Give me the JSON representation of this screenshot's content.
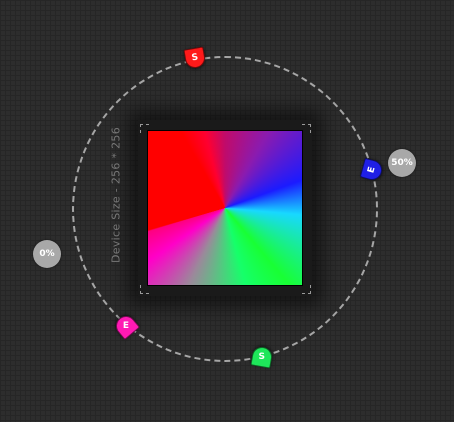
{
  "canvas": {
    "device_size_label": "Device Size - 256 * 256"
  },
  "percent_badges": {
    "left": "0%",
    "right": "50%"
  },
  "handles": [
    {
      "name": "red-start",
      "label": "S",
      "color": "#ff1a1a"
    },
    {
      "name": "blue-end",
      "label": "E",
      "color": "#1f1fe6"
    },
    {
      "name": "green-start",
      "label": "S",
      "color": "#1ee65a"
    },
    {
      "name": "pink-end",
      "label": "E",
      "color": "#ff1ab4"
    }
  ],
  "colors": {
    "background": "#2d2d2d",
    "ring": "#a6a6a6",
    "badge": "#a8a8a8"
  }
}
